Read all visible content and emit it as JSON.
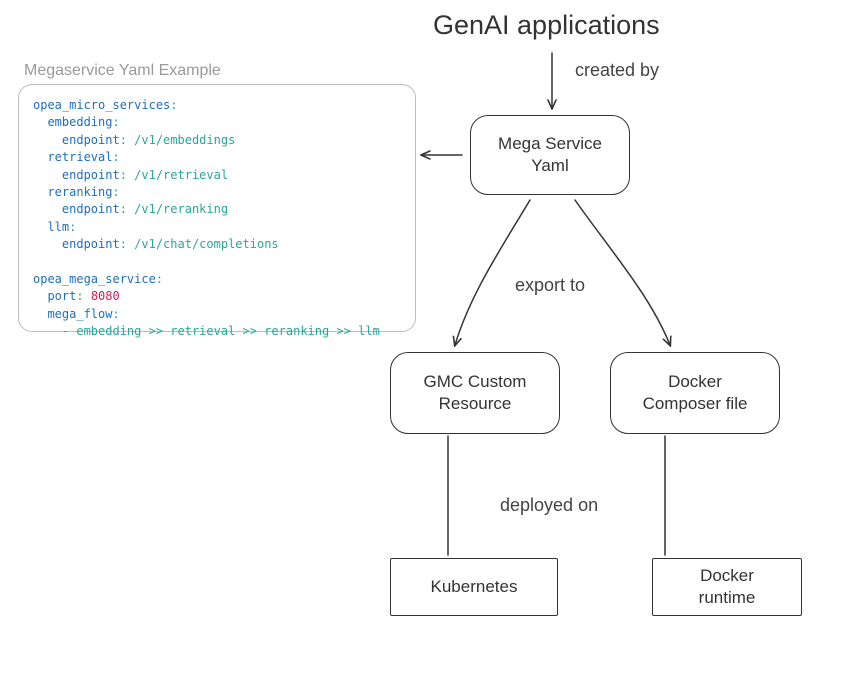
{
  "title": "GenAI applications",
  "labels": {
    "created_by": "created by",
    "export_to": "export to",
    "deployed_on": "deployed on"
  },
  "nodes": {
    "mega_yaml": "Mega Service\nYaml",
    "gmc": "GMC Custom\nResource",
    "docker_compose": "Docker\nComposer file",
    "kubernetes": "Kubernetes",
    "docker_runtime": "Docker\nruntime"
  },
  "panel": {
    "caption": "Megaservice Yaml Example",
    "yaml": {
      "micro_key": "opea_micro_services",
      "services": [
        {
          "name": "embedding",
          "endpoint_key": "endpoint",
          "endpoint": "/v1/embeddings"
        },
        {
          "name": "retrieval",
          "endpoint_key": "endpoint",
          "endpoint": "/v1/retrieval"
        },
        {
          "name": "reranking",
          "endpoint_key": "endpoint",
          "endpoint": "/v1/reranking"
        },
        {
          "name": "llm",
          "endpoint_key": "endpoint",
          "endpoint": "/v1/chat/completions"
        }
      ],
      "mega_key": "opea_mega_service",
      "port_key": "port",
      "port": "8080",
      "flow_key": "mega_flow",
      "flow_line": "- embedding >> retrieval >> reranking >> llm"
    }
  }
}
